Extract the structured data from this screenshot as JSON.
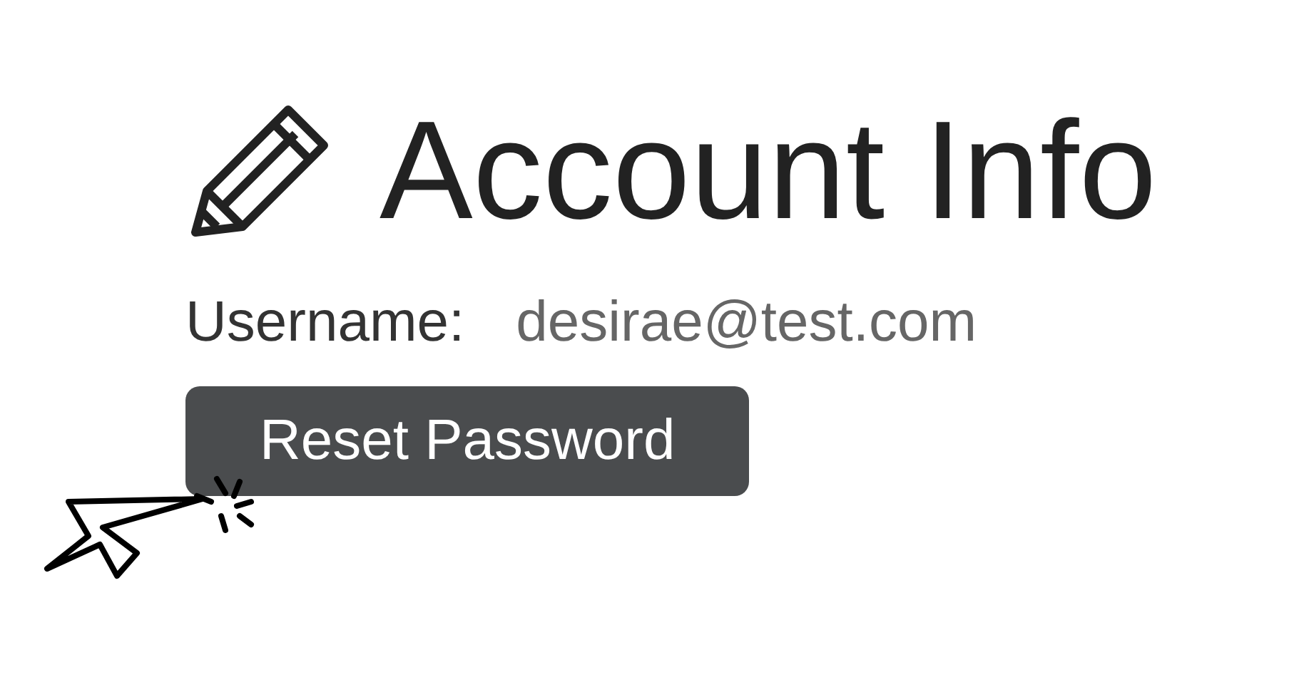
{
  "title": "Account Info",
  "fields": [
    {
      "label": "Username:",
      "value": "desirae@test.com"
    }
  ],
  "buttons": [
    {
      "label": "Reset Password"
    }
  ]
}
